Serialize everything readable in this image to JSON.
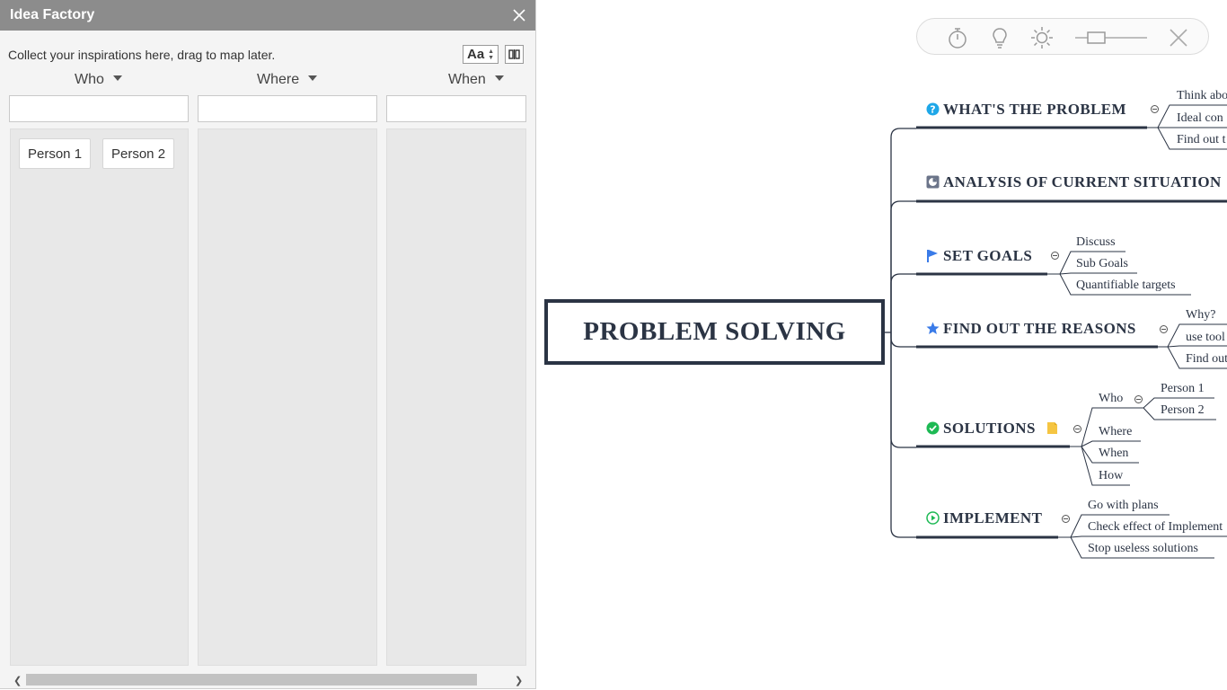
{
  "panel": {
    "title": "Idea Factory",
    "hint": "Collect your inspirations here, drag to map later.",
    "font_button": "Aa",
    "columns": [
      {
        "header": "Who",
        "cards": [
          "Person 1",
          "Person 2"
        ]
      },
      {
        "header": "Where",
        "cards": []
      },
      {
        "header": "When",
        "cards": []
      }
    ]
  },
  "toolbar": {
    "icons": [
      "stopwatch-icon",
      "lightbulb-icon",
      "brightness-icon",
      "zoom-slider",
      "close-icon"
    ]
  },
  "map": {
    "central": "PROBLEM SOLVING",
    "topics": [
      {
        "label": "WHAT'S THE PROBLEM",
        "icon": "question-icon",
        "subtopics": [
          "Think abo",
          "Ideal con",
          "Find out t"
        ]
      },
      {
        "label": "ANALYSIS OF CURRENT SITUATION",
        "icon": "chart-icon",
        "subtopics": []
      },
      {
        "label": "SET GOALS",
        "icon": "flag-icon",
        "subtopics": [
          "Discuss",
          "Sub Goals",
          "Quantifiable targets"
        ]
      },
      {
        "label": "FIND OUT THE REASONS",
        "icon": "star-icon",
        "subtopics": [
          "Why?",
          "use tool",
          "Find out"
        ]
      },
      {
        "label": "SOLUTIONS",
        "icon": "check-icon",
        "subtopics": [
          "Who",
          "Where",
          "When",
          "How"
        ],
        "who_children": [
          "Person 1",
          "Person 2"
        ]
      },
      {
        "label": "IMPLEMENT",
        "icon": "play-icon",
        "subtopics": [
          "Go with plans",
          "Check effect of Implement",
          "Stop useless solutions"
        ]
      }
    ]
  },
  "colors": {
    "line": "#2b3444",
    "panel_title_bg": "#8c8c8c",
    "question": "#1ea7e8",
    "flag": "#3a7be8",
    "check": "#1db954",
    "note": "#f5c542"
  }
}
